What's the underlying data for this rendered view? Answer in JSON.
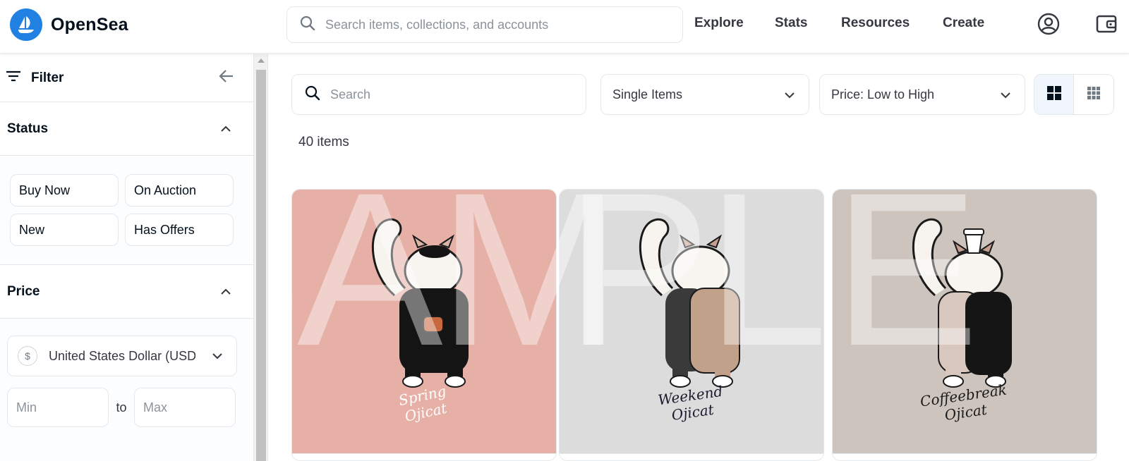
{
  "header": {
    "brand": "OpenSea",
    "search_placeholder": "Search items, collections, and accounts",
    "nav": [
      "Explore",
      "Stats",
      "Resources",
      "Create"
    ],
    "icons": [
      "profile-icon",
      "wallet-icon"
    ],
    "accent": "#2081e2"
  },
  "sidebar": {
    "filter_title": "Filter",
    "status": {
      "title": "Status",
      "options": [
        "Buy Now",
        "On Auction",
        "New",
        "Has Offers"
      ]
    },
    "price": {
      "title": "Price",
      "currency": "United States Dollar (USD)",
      "min_placeholder": "Min",
      "to": "to",
      "max_placeholder": "Max"
    }
  },
  "main": {
    "search_placeholder": "Search",
    "type_filter": "Single Items",
    "sort": "Price: Low to High",
    "count": "40 items",
    "watermark": "SAMPLE",
    "cards": [
      {
        "bg": "#e6b0a6",
        "caption_line1": "Spring",
        "caption_line2": "Ojicat",
        "caption_color": "#ffffff"
      },
      {
        "bg": "#dcdcdd",
        "caption_line1": "Weekend",
        "caption_line2": "Ojicat",
        "caption_color": "#1a1a2e"
      },
      {
        "bg": "#cdc4bd",
        "caption_line1": "Coffeebreak",
        "caption_line2": "Ojicat",
        "caption_color": "#1a1a1a"
      }
    ]
  }
}
